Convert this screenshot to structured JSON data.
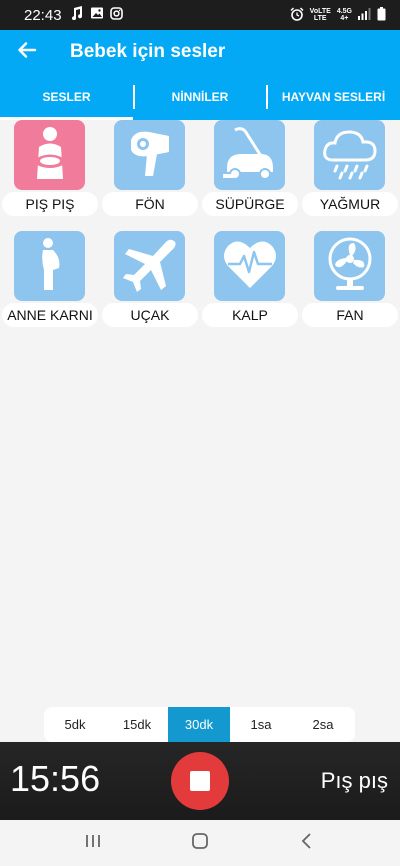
{
  "status": {
    "time": "22:43",
    "lte_top": "VoLTE",
    "lte_bottom": "LTE",
    "net_top": "4.5G",
    "net_bottom": "4+"
  },
  "appbar": {
    "title": "Bebek için sesler",
    "back_icon": "arrow-back-icon"
  },
  "tabs": [
    {
      "label": "SESLER",
      "active": true
    },
    {
      "label": "NİNNİLER",
      "active": false
    },
    {
      "label": "HAYVAN SESLERİ",
      "active": false
    }
  ],
  "sounds": [
    {
      "label": "PIŞ PIŞ",
      "icon": "mother-baby-icon",
      "color": "#f17b9a"
    },
    {
      "label": "FÖN",
      "icon": "hair-dryer-icon",
      "color": "#8ec5ef"
    },
    {
      "label": "SÜPÜRGE",
      "icon": "vacuum-cleaner-icon",
      "color": "#8ec5ef"
    },
    {
      "label": "YAĞMUR",
      "icon": "rain-cloud-icon",
      "color": "#8ec5ef"
    },
    {
      "label": "ANNE KARNI",
      "icon": "pregnant-woman-icon",
      "color": "#8ec5ef"
    },
    {
      "label": "UÇAK",
      "icon": "airplane-icon",
      "color": "#8ec5ef"
    },
    {
      "label": "KALP",
      "icon": "heartbeat-icon",
      "color": "#8ec5ef"
    },
    {
      "label": "FAN",
      "icon": "fan-icon",
      "color": "#8ec5ef"
    }
  ],
  "timers": [
    {
      "label": "5dk",
      "active": false
    },
    {
      "label": "15dk",
      "active": false
    },
    {
      "label": "30dk",
      "active": true
    },
    {
      "label": "1sa",
      "active": false
    },
    {
      "label": "2sa",
      "active": false
    }
  ],
  "player": {
    "remaining": "15:56",
    "now_playing": "Pış pış",
    "stop_icon": "stop-icon",
    "accent": "#e33b3b"
  },
  "colors": {
    "primary": "#03a9f4",
    "tile": "#8ec5ef",
    "tile_active": "#f17b9a",
    "timer_active": "#1399cf"
  }
}
